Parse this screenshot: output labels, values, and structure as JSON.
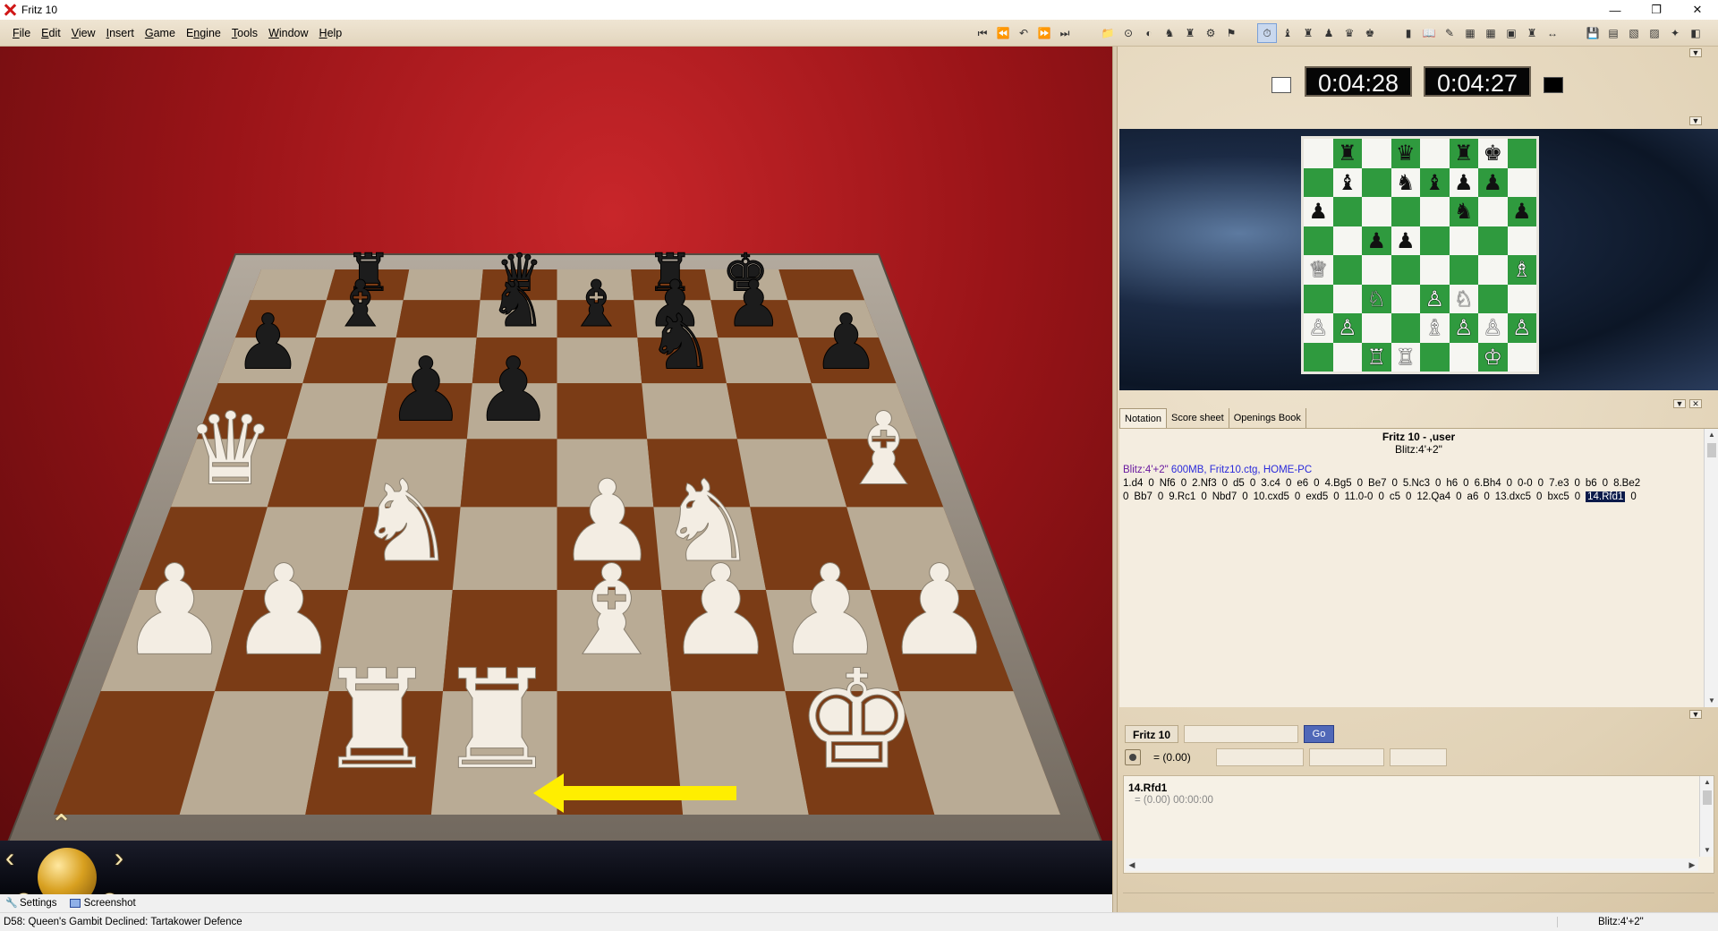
{
  "window": {
    "title": "Fritz 10",
    "controls": [
      "—",
      "❐",
      "✕"
    ]
  },
  "menu": [
    "File",
    "Edit",
    "View",
    "Insert",
    "Game",
    "Engine",
    "Tools",
    "Window",
    "Help"
  ],
  "menu_accel": [
    "F",
    "E",
    "V",
    "I",
    "G",
    "n",
    "T",
    "W",
    "H"
  ],
  "toolbar": {
    "nav_icons": [
      "⏮",
      "⏪",
      "↶",
      "⏩",
      "⏭"
    ],
    "game_icons": [
      "📁",
      "⊙",
      "◐",
      "♞",
      "♜",
      "⚙",
      "⚑"
    ],
    "view_icons": [
      "⏱",
      "♝",
      "♜",
      "♟",
      "♛",
      "♚"
    ],
    "tool_icons": [
      "▮",
      "📖",
      "✎",
      "▦",
      "▦",
      "▣",
      "♜",
      "↔"
    ],
    "window_icons": [
      "💾",
      "▤",
      "▧",
      "▨",
      "✦",
      "◧"
    ]
  },
  "clocks": {
    "white_time": "0:04:28",
    "black_time": "0:04:27"
  },
  "mini_board": [
    [
      "",
      "♜",
      "",
      "♛",
      "",
      "♜",
      "♚",
      ""
    ],
    [
      "",
      "♝",
      "",
      "♞",
      "♝",
      "♟",
      "♟",
      ""
    ],
    [
      "♟",
      "",
      "",
      "",
      "",
      "♞",
      "",
      "♟"
    ],
    [
      "",
      "",
      "♟",
      "♟",
      "",
      "",
      "",
      ""
    ],
    [
      "♕",
      "",
      "",
      "",
      "",
      "",
      "",
      "♗"
    ],
    [
      "",
      "",
      "♘",
      "",
      "♙",
      "♘",
      "",
      ""
    ],
    [
      "♙",
      "♙",
      "",
      "",
      "♗",
      "♙",
      "♙",
      "♙"
    ],
    [
      "",
      "",
      "♖",
      "♖",
      "",
      "",
      "♔",
      ""
    ]
  ],
  "tabs": [
    "Notation",
    "Score sheet",
    "Openings Book"
  ],
  "notation": {
    "title": "Fritz 10 - ,user",
    "subtitle": "Blitz:4'+2\"",
    "meta_event": "Blitz:4'+2\"",
    "meta_rest": "600MB, Fritz10.ctg, HOME-PC",
    "moves_line1": [
      "1.d4",
      "0",
      "Nf6",
      "0",
      "2.Nf3",
      "0",
      "d5",
      "0",
      "3.c4",
      "0",
      "e6",
      "0",
      "4.Bg5",
      "0",
      "Be7",
      "0",
      "5.Nc3",
      "0",
      "h6",
      "0",
      "6.Bh4",
      "0",
      "0-0",
      "0",
      "7.e3",
      "0",
      "b6",
      "0",
      "8.Be2"
    ],
    "moves_line2": [
      "0",
      "Bb7",
      "0",
      "9.Rc1",
      "0",
      "Nbd7",
      "0",
      "10.cxd5",
      "0",
      "exd5",
      "0",
      "11.0-0",
      "0",
      "c5",
      "0",
      "12.Qa4",
      "0",
      "a6",
      "0",
      "13.dxc5",
      "0",
      "bxc5",
      "0"
    ],
    "current_move": "14.Rfd1",
    "after_current": "0"
  },
  "engine": {
    "name": "Fritz 10",
    "go_label": "Go",
    "eval": "= (0.00)",
    "out_move": "14.Rfd1",
    "out_line": "=  (0.00)    00:00:00"
  },
  "bottom_bar": {
    "settings_label": "Settings",
    "screenshot_label": "Screenshot"
  },
  "status": {
    "opening": "D58: Queen's Gambit Declined: Tartakower Defence",
    "time_control": "Blitz:4'+2\""
  },
  "colors": {
    "arrow": "#ffee00",
    "board_dark": "#2f9a3e",
    "board_light": "#f6f6f2",
    "backdrop": "#9a1418"
  }
}
